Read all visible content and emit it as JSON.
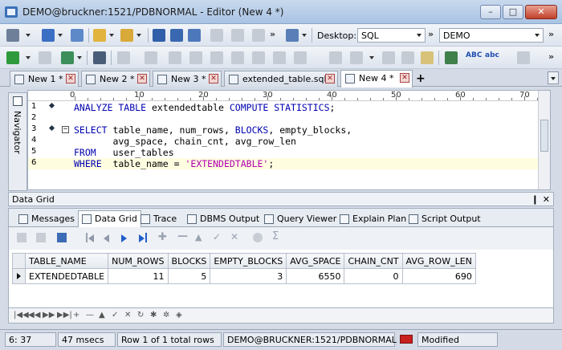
{
  "window": {
    "title": "DEMO@bruckner:1521/PDBNORMAL - Editor (New 4 *)"
  },
  "toolbar": {
    "desktop_label": "Desktop:",
    "desktop_value": "SQL",
    "schema_value": "DEMO"
  },
  "tabs": [
    {
      "label": "New 1 *"
    },
    {
      "label": "New 2 *"
    },
    {
      "label": "New 3 *"
    },
    {
      "label": "extended_table.sql"
    },
    {
      "label": "New 4 *"
    }
  ],
  "navigator": {
    "label": "Navigator"
  },
  "ruler": [
    "0",
    "10",
    "20",
    "30",
    "40",
    "50",
    "60",
    "70"
  ],
  "editor": {
    "lines": [
      {
        "num": "1",
        "parts": [
          [
            "kw",
            "ANALYZE TABLE "
          ],
          [
            "t",
            "extendedtable "
          ],
          [
            "kw",
            "COMPUTE STATISTICS"
          ],
          [
            "t",
            ";"
          ]
        ]
      },
      {
        "num": "2",
        "parts": []
      },
      {
        "num": "3",
        "parts": [
          [
            "kw",
            "SELECT "
          ],
          [
            "t",
            "table_name, num_rows, "
          ],
          [
            "kw",
            "BLOCKS"
          ],
          [
            "t",
            ", empty_blocks,"
          ]
        ]
      },
      {
        "num": "4",
        "parts": [
          [
            "t",
            "       avg_space, chain_cnt, avg_row_len"
          ]
        ]
      },
      {
        "num": "5",
        "parts": [
          [
            "kw",
            "FROM   "
          ],
          [
            "t",
            "user_tables"
          ]
        ]
      },
      {
        "num": "6",
        "parts": [
          [
            "kw",
            "WHERE  "
          ],
          [
            "t",
            "table_name = "
          ],
          [
            "str",
            "'EXTENDEDTABLE'"
          ],
          [
            "t",
            ";"
          ]
        ]
      }
    ]
  },
  "panel": {
    "title": "Data Grid",
    "pin": "❙",
    "close": "✕",
    "subtabs": [
      "Messages",
      "Data Grid",
      "Trace",
      "DBMS Output",
      "Query Viewer",
      "Explain Plan",
      "Script Output"
    ]
  },
  "grid": {
    "columns": [
      "TABLE_NAME",
      "NUM_ROWS",
      "BLOCKS",
      "EMPTY_BLOCKS",
      "AVG_SPACE",
      "CHAIN_CNT",
      "AVG_ROW_LEN"
    ],
    "rows": [
      [
        "EXTENDEDTABLE",
        "11",
        "5",
        "3",
        "6550",
        "0",
        "690"
      ]
    ]
  },
  "status": {
    "position": "6:  37",
    "time": "47 msecs",
    "rows": "Row 1 of 1 total rows",
    "connection": "DEMO@BRUCKNER:1521/PDBNORMAL",
    "state": "Modified"
  }
}
